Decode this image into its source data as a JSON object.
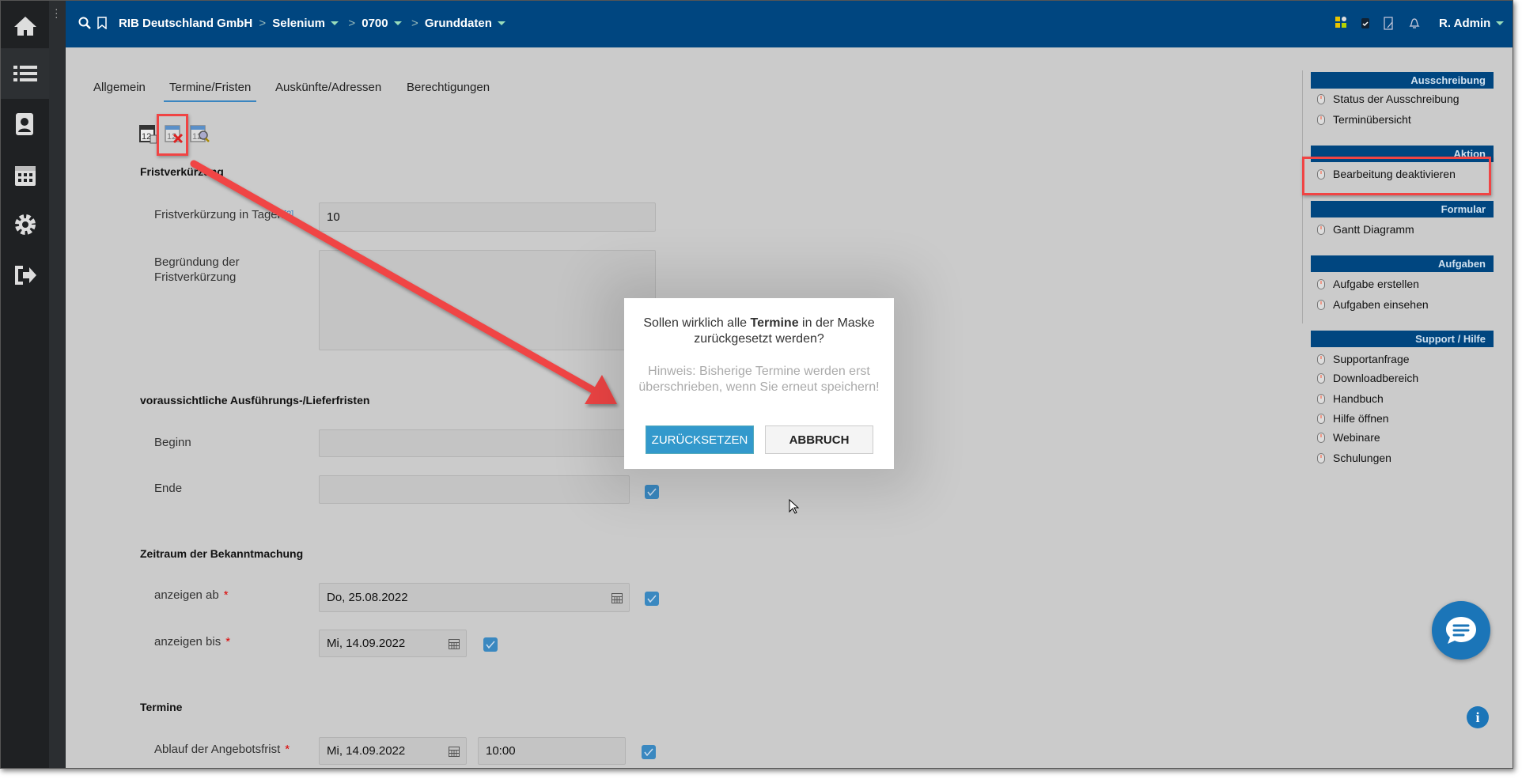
{
  "breadcrumb": {
    "company": "RIB Deutschland GmbH",
    "project": "Selenium",
    "number": "0700",
    "section": "Grunddaten"
  },
  "user": {
    "name": "R. Admin"
  },
  "tabs": [
    {
      "label": "Allgemein"
    },
    {
      "label": "Termine/Fristen",
      "active": true
    },
    {
      "label": "Auskünfte/Adressen"
    },
    {
      "label": "Berechtigungen"
    }
  ],
  "toolbar": {
    "icons": [
      "calendar-apply-icon",
      "calendar-reset-icon",
      "calendar-search-icon"
    ]
  },
  "form": {
    "s1": {
      "title": "Fristverkürzung",
      "days_label": "Fristverkürzung in Tagen",
      "help": "[?]",
      "days_value": "10",
      "reason_label1": "Begründung der",
      "reason_label2": "Fristverkürzung",
      "reason_value": ""
    },
    "s2": {
      "title": "voraussichtliche Ausführungs-/Lieferfristen",
      "begin_label": "Beginn",
      "begin_value": "",
      "end_label": "Ende",
      "end_value": "",
      "end_checked": true
    },
    "s3": {
      "title": "Zeitraum der Bekanntmachung",
      "from_label": "anzeigen ab",
      "from_value": "Do, 25.08.2022",
      "to_label": "anzeigen bis",
      "to_value": "Mi, 14.09.2022",
      "required": "*"
    },
    "s4": {
      "title": "Termine",
      "deadline_label": "Ablauf der Angebotsfrist",
      "deadline_date": "Mi, 14.09.2022",
      "deadline_time": "10:00"
    }
  },
  "panel": {
    "sections": [
      {
        "title": "Ausschreibung",
        "items": [
          "Status der Ausschreibung",
          "Terminübersicht"
        ]
      },
      {
        "title": "Aktion",
        "items": [
          "Bearbeitung deaktivieren"
        ]
      },
      {
        "title": "Formular",
        "items": [
          "Gantt Diagramm"
        ]
      },
      {
        "title": "Aufgaben",
        "items": [
          "Aufgabe erstellen",
          "Aufgaben einsehen"
        ]
      },
      {
        "title": "Support / Hilfe",
        "items": [
          "Supportanfrage",
          "Downloadbereich",
          "Handbuch",
          "Hilfe öffnen",
          "Webinare",
          "Schulungen"
        ]
      }
    ]
  },
  "dialog": {
    "q_pre": "Sollen wirklich alle ",
    "q_bold": "Termine",
    "q_post": " in der Maske zurückgesetzt werden?",
    "hint": "Hinweis: Bisherige Termine werden erst überschrieben, wenn Sie erneut speichern!",
    "confirm": "ZURÜCKSETZEN",
    "cancel": "ABBRUCH"
  },
  "colors": {
    "topbar": "#004680",
    "accent": "#3399cc",
    "annotation": "#f04444"
  }
}
